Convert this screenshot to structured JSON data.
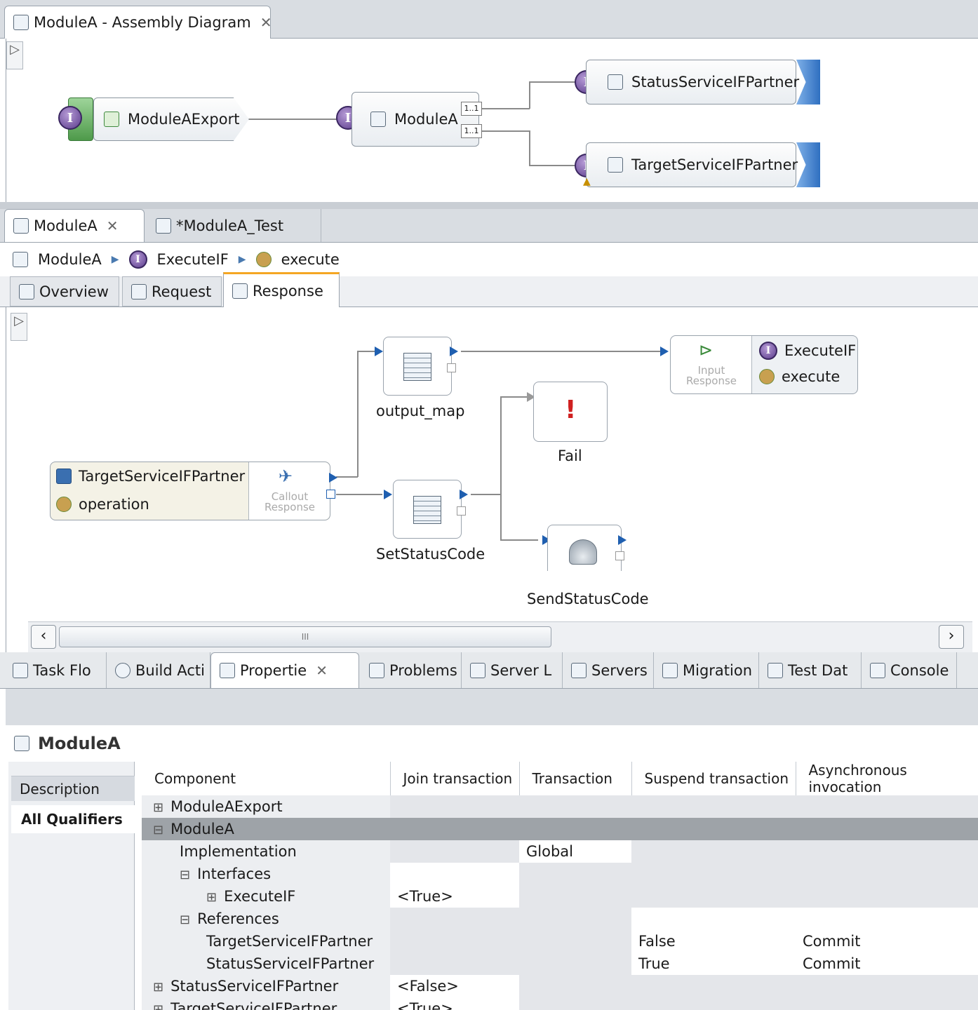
{
  "assembly_editor": {
    "tab_title": "ModuleA - Assembly Diagram",
    "export_label": "ModuleAExport",
    "module_label": "ModuleA",
    "multiplicity_1": "1..1",
    "multiplicity_2": "1..1",
    "partner_1": "StatusServiceIFPartner",
    "partner_2": "TargetServiceIFPartner",
    "interface_glyph": "I"
  },
  "mediation_editor": {
    "tabs": [
      "ModuleA",
      "*ModuleA_Test"
    ],
    "breadcrumb": [
      "ModuleA",
      "ExecuteIF",
      "execute"
    ],
    "subtabs": [
      "Overview",
      "Request",
      "Response"
    ],
    "nodes": {
      "output_map": "output_map",
      "fail": "Fail",
      "set_status": "SetStatusCode",
      "send_status": "SendStatusCode",
      "callout_partner": "TargetServiceIFPartner",
      "callout_operation": "operation",
      "callout_response": "Callout Response",
      "input_response": "Input Response",
      "target_interface": "ExecuteIF",
      "target_operation": "execute"
    },
    "scroll_thumb": "III"
  },
  "views": {
    "tabs": [
      "Task Flo",
      "Build Acti",
      "Propertie",
      "Problems",
      "Server L",
      "Servers",
      "Migration",
      "Test Dat",
      "Console"
    ]
  },
  "properties": {
    "title": "ModuleA",
    "side_tabs": [
      "Description",
      "All Qualifiers"
    ],
    "columns": [
      "Component",
      "Join transaction",
      "Transaction",
      "Suspend transaction",
      "Asynchronous invocation"
    ],
    "rows": [
      {
        "toggle": "⊞",
        "name": "ModuleAExport",
        "join": "",
        "tx": "",
        "suspend": "",
        "async": ""
      },
      {
        "toggle": "⊟",
        "name": "ModuleA",
        "join": "",
        "tx": "",
        "suspend": "",
        "async": ""
      },
      {
        "toggle": "",
        "name": "Implementation",
        "join": "",
        "tx": "Global",
        "suspend": "",
        "async": ""
      },
      {
        "toggle": "⊟",
        "name": "Interfaces",
        "join": "",
        "tx": "",
        "suspend": "",
        "async": ""
      },
      {
        "toggle": "⊞",
        "name": "ExecuteIF",
        "join": "<True>",
        "tx": "",
        "suspend": "",
        "async": ""
      },
      {
        "toggle": "⊟",
        "name": "References",
        "join": "",
        "tx": "",
        "suspend": "",
        "async": ""
      },
      {
        "toggle": "",
        "name": "TargetServiceIFPartner",
        "join": "",
        "tx": "",
        "suspend": "False",
        "async": "Commit"
      },
      {
        "toggle": "",
        "name": "StatusServiceIFPartner",
        "join": "",
        "tx": "",
        "suspend": "True",
        "async": "Commit"
      },
      {
        "toggle": "⊞",
        "name": "StatusServiceIFPartner",
        "join": "<False>",
        "tx": "",
        "suspend": "",
        "async": ""
      },
      {
        "toggle": "⊞",
        "name": "TargetServiceIFPartner",
        "join": "<True>",
        "tx": "",
        "suspend": "",
        "async": ""
      }
    ]
  }
}
